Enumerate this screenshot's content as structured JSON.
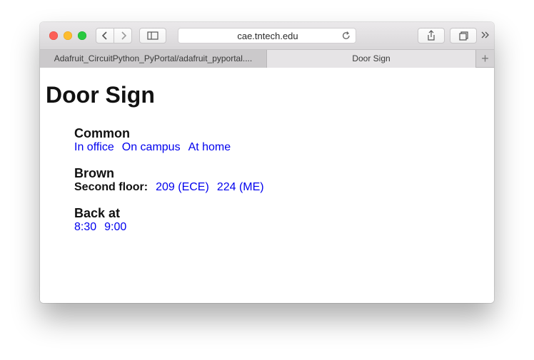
{
  "browser": {
    "url": "cae.tntech.edu",
    "tabs": [
      {
        "label": "Adafruit_CircuitPython_PyPortal/adafruit_pyportal...."
      },
      {
        "label": "Door Sign"
      }
    ],
    "new_tab_symbol": "+"
  },
  "page": {
    "title": "Door Sign",
    "sections": [
      {
        "heading": "Common",
        "links": [
          "In office",
          "On campus",
          "At home"
        ]
      },
      {
        "heading": "Brown",
        "row_label": "Second floor:",
        "links": [
          "209 (ECE)",
          "224 (ME)"
        ]
      },
      {
        "heading": "Back at",
        "links": [
          "8:30",
          "9:00"
        ]
      }
    ]
  },
  "colors": {
    "link": "#0000ee",
    "close": "#fc5f57",
    "minimize": "#fdbc2e",
    "zoom": "#29c940"
  },
  "icons": [
    "back-icon",
    "forward-icon",
    "sidebar-icon",
    "reload-icon",
    "share-icon",
    "tabs-overview-icon",
    "overflow-chevron-icon"
  ]
}
